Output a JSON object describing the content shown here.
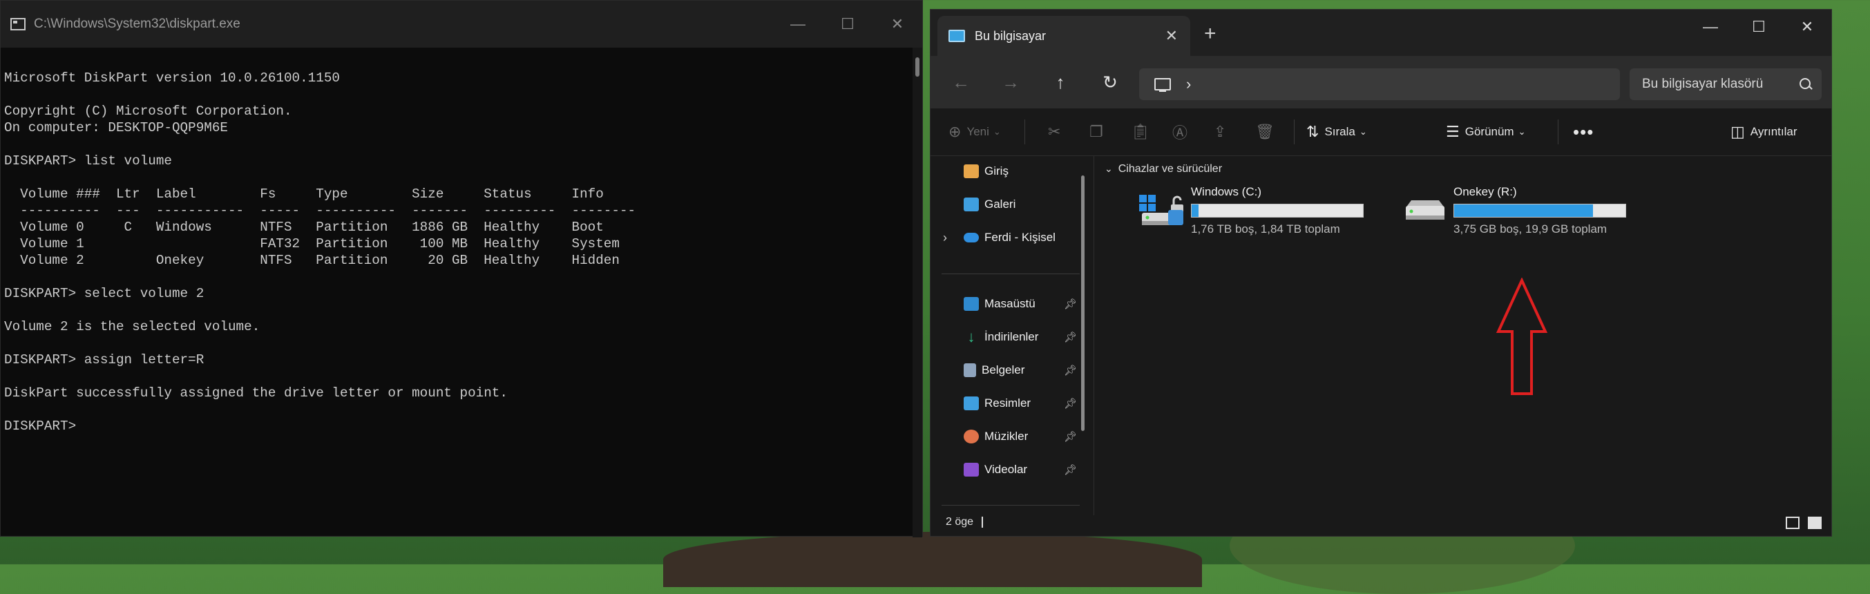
{
  "cmd": {
    "title": "C:\\Windows\\System32\\diskpart.exe",
    "lines": [
      "",
      "Microsoft DiskPart version 10.0.26100.1150",
      "",
      "Copyright (C) Microsoft Corporation.",
      "On computer: DESKTOP-QQP9M6E",
      "",
      "DISKPART> list volume",
      "",
      "  Volume ###  Ltr  Label        Fs     Type        Size     Status     Info",
      "  ----------  ---  -----------  -----  ----------  -------  ---------  --------",
      "  Volume 0     C   Windows      NTFS   Partition   1886 GB  Healthy    Boot",
      "  Volume 1                      FAT32  Partition    100 MB  Healthy    System",
      "  Volume 2         Onekey       NTFS   Partition     20 GB  Healthy    Hidden",
      "",
      "DISKPART> select volume 2",
      "",
      "Volume 2 is the selected volume.",
      "",
      "DISKPART> assign letter=R",
      "",
      "DiskPart successfully assigned the drive letter or mount point.",
      "",
      "DISKPART>"
    ]
  },
  "explorer": {
    "tab_title": "Bu bilgisayar",
    "search_placeholder": "Bu bilgisayar klasörü",
    "toolbar": {
      "new_label": "Yeni",
      "sort_label": "Sırala",
      "view_label": "Görünüm",
      "details_label": "Ayrıntılar"
    },
    "sidebar": {
      "home": "Giriş",
      "gallery": "Galeri",
      "onedrive": "Ferdi - Kişisel",
      "desktop": "Masaüstü",
      "downloads": "İndirilenler",
      "documents": "Belgeler",
      "pictures": "Resimler",
      "music": "Müzikler",
      "videos": "Videolar"
    },
    "group_header": "Cihazlar ve sürücüler",
    "drives": [
      {
        "name": "Windows (C:)",
        "detail": "1,76 TB boş, 1,84 TB toplam",
        "used_fraction": 0.04
      },
      {
        "name": "Onekey (R:)",
        "detail": "3,75 GB boş, 19,9 GB toplam",
        "used_fraction": 0.81
      }
    ],
    "status": "2 öge"
  }
}
